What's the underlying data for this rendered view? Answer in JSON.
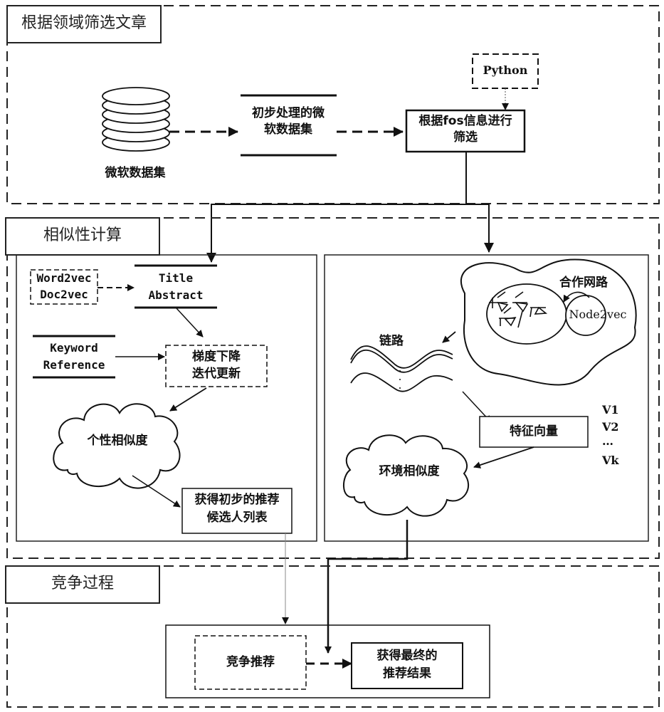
{
  "sections": {
    "filter": {
      "label": "根据领域筛选文章"
    },
    "similarity": {
      "label": "相似性计算"
    },
    "competition": {
      "label": "竞争过程"
    }
  },
  "filter": {
    "database_label": "微软数据集",
    "processed_dataset": [
      "初步处理的微",
      "软数据集"
    ],
    "python_label": "Python",
    "fos_filter": [
      "根据fos信息进行",
      "筛选"
    ]
  },
  "left_panel": {
    "embedding_models": [
      "Word2vec",
      "Doc2vec"
    ],
    "title_abstract": [
      "Title",
      "Abstract"
    ],
    "keyword_reference": [
      "Keyword",
      "Reference"
    ],
    "gradient_descent": [
      "梯度下降",
      "迭代更新"
    ],
    "personal_similarity": "个性相似度",
    "candidate_list": [
      "获得初步的推荐",
      "候选人列表"
    ]
  },
  "right_panel": {
    "cooperation_network": "合作网路",
    "node2vec": "Node2vec",
    "links": "链路",
    "feature_vector": "特征向量",
    "vectors": [
      "V1",
      "V2",
      "…",
      "Vk"
    ],
    "environment_similarity": "环境相似度"
  },
  "competition": {
    "competitive_recommendation": "竞争推荐",
    "final_result": [
      "获得最终的",
      "推荐结果"
    ]
  }
}
